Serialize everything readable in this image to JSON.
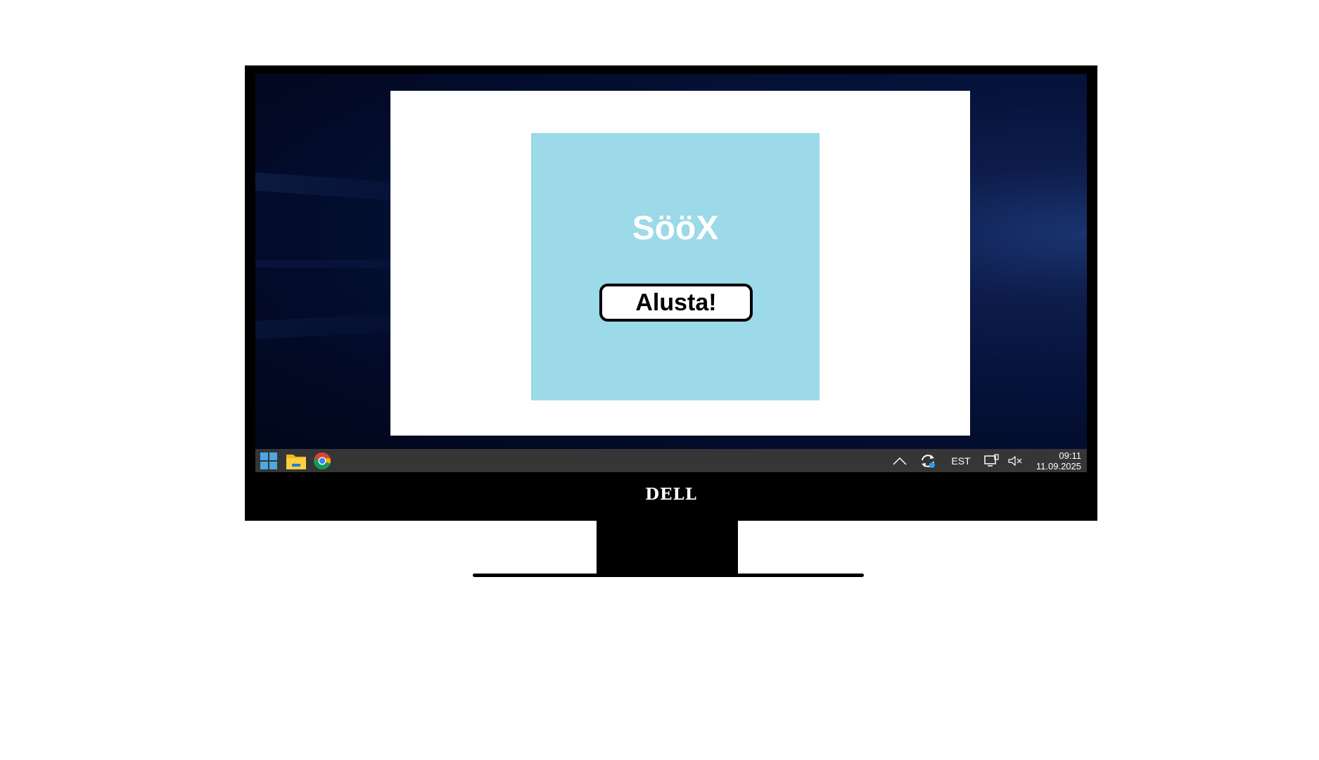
{
  "monitor": {
    "brand": "DELL"
  },
  "app": {
    "title": "SööX",
    "start_button_label": "Alusta!"
  },
  "taskbar": {
    "left_icons": [
      "windows-start-icon",
      "file-explorer-icon",
      "chrome-icon"
    ],
    "tray": {
      "overflow_icon": "chevron-up-icon",
      "sync_icon": "sync-icon",
      "language": "EST",
      "network_icon": "network-icon",
      "volume_icon": "volume-muted-icon"
    },
    "clock": {
      "time": "09:11",
      "date": "11.09.2025"
    }
  },
  "colors": {
    "app_panel": "#9cd9e9",
    "taskbar": "#363636",
    "monitor_bezel": "#000000",
    "windows_logo": "#4ea7e0"
  }
}
